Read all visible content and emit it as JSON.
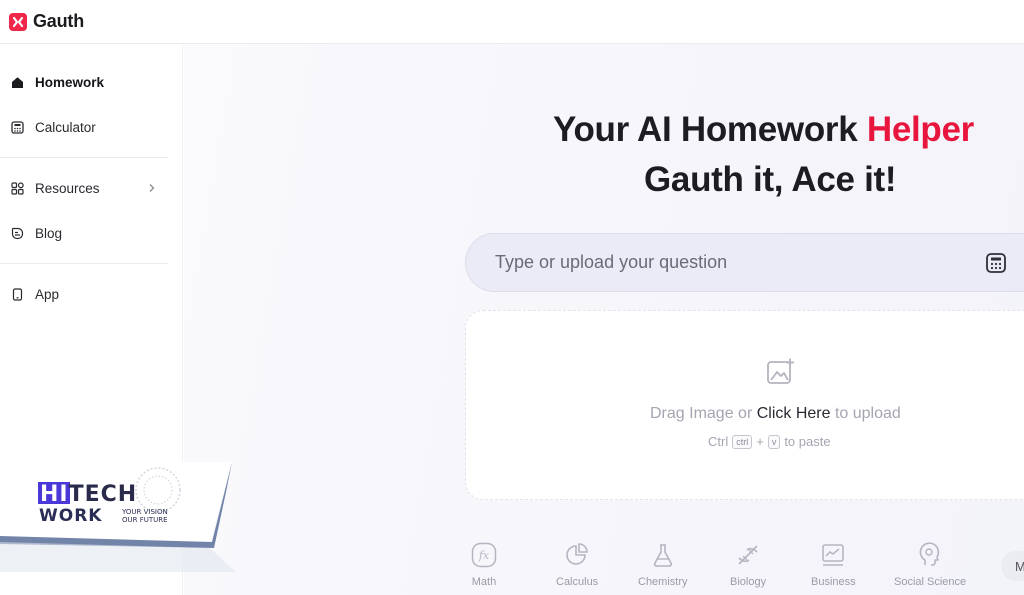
{
  "header": {
    "brand": "Gauth"
  },
  "sidebar": {
    "items": [
      {
        "label": "Homework",
        "icon": "home-icon",
        "active": true
      },
      {
        "label": "Calculator",
        "icon": "calculator-icon"
      },
      {
        "label": "Resources",
        "icon": "grid-icon",
        "has_submenu": true
      },
      {
        "label": "Blog",
        "icon": "blog-icon"
      },
      {
        "label": "App",
        "icon": "phone-icon"
      }
    ]
  },
  "hero": {
    "line1_main": "Your AI Homework ",
    "line1_highlight": "Helper",
    "line2": "Gauth it, Ace it!"
  },
  "search": {
    "placeholder": "Type or upload your question"
  },
  "upload": {
    "text_before": "Drag Image or ",
    "link_text": "Click Here",
    "text_after": " to upload",
    "hint_prefix": "Ctrl",
    "key1": "ctrl",
    "plus": "+",
    "key2": "v",
    "hint_suffix": "to paste"
  },
  "subjects": [
    {
      "label": "Math",
      "icon": "fx-icon"
    },
    {
      "label": "Calculus",
      "icon": "pie-chart-icon"
    },
    {
      "label": "Chemistry",
      "icon": "flask-icon"
    },
    {
      "label": "Biology",
      "icon": "dna-icon"
    },
    {
      "label": "Business",
      "icon": "line-chart-icon"
    },
    {
      "label": "Social Science",
      "icon": "head-icon"
    }
  ],
  "more_label": "M",
  "watermark": {
    "line1": "HITECH",
    "line2": "WORK",
    "tagline1": "YOUR VISION",
    "tagline2": "OUR FUTURE"
  },
  "colors": {
    "brand": "#f0264a",
    "highlight": "#e8153d"
  }
}
